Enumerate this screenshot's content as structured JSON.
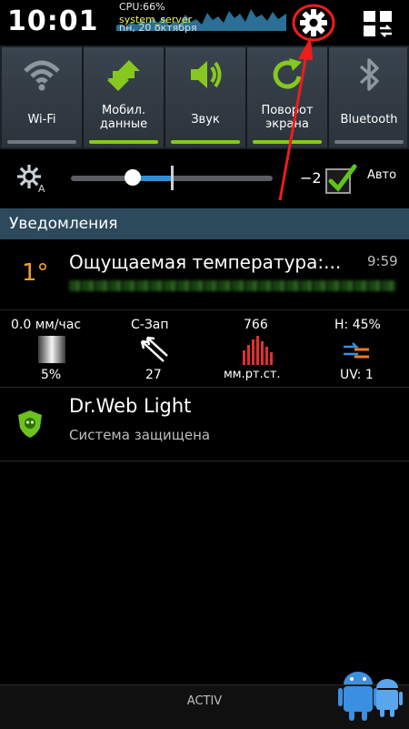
{
  "status": {
    "time": "10:01",
    "cpu_label": "CPU:66%",
    "cpu_process": "system_server",
    "date": "пн, 20 октября"
  },
  "toggles": [
    {
      "label": "Wi-Fi",
      "icon": "wifi-icon",
      "active": false
    },
    {
      "label": "Мобил. данные",
      "icon": "mobile-data-icon",
      "active": true
    },
    {
      "label": "Звук",
      "icon": "sound-icon",
      "active": true
    },
    {
      "label": "Поворот экрана",
      "icon": "rotate-icon",
      "active": true
    },
    {
      "label": "Bluetooth",
      "icon": "bluetooth-icon",
      "active": false
    }
  ],
  "brightness": {
    "value": "−2",
    "auto_label": "Авто",
    "auto_checked": true,
    "level_fraction": 0.34
  },
  "notifications": {
    "header": "Уведомления",
    "weather": {
      "icon_text": "1°",
      "title": "Ощущаемая температура:...",
      "time": "9:59",
      "precip": "0.0 мм/час",
      "precip_prob": "5%",
      "wind_dir": "С-Зап",
      "wind_speed": "27",
      "pressure": "766",
      "pressure_unit": "мм.рт.ст.",
      "humidity": "H: 45%",
      "uv": "UV: 1"
    },
    "drweb": {
      "title": "Dr.Web Light",
      "subtitle": "Система защищена"
    }
  },
  "carrier": "ACTIV",
  "colors": {
    "active_bar": "#86c81f",
    "inactive_bar": "#6f7880",
    "notif_header": "#2c4a5c",
    "accent_red": "#ee1c1c",
    "brightness_fill": "#2e8fd8"
  }
}
